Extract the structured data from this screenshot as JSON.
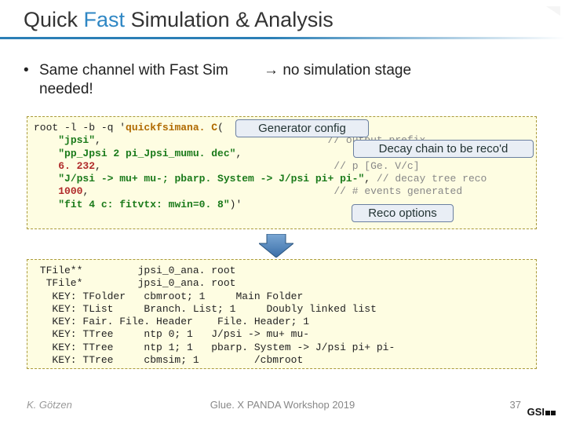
{
  "title": {
    "w1": "Quick",
    "w2": "Fast",
    "w3": "Simulation & Analysis"
  },
  "bullet": {
    "line1a": "Same channel with Fast Sim",
    "line1b": "→ no simulation stage",
    "line2": "needed!"
  },
  "callouts": {
    "gen": "Generator config",
    "decay": "Decay chain to be reco'd",
    "reco": "Reco options"
  },
  "code1": {
    "l1a": "root -l -b -q '",
    "l1b": "quickfsimana. C",
    "l1c": "(",
    "l2a": "\"jpsi\"",
    "l2b": ",",
    "l2c": "// output prefix",
    "l3a": "\"pp_Jpsi 2 pi_Jpsi_mumu. dec\"",
    "l3b": ",",
    "l4a": "6. 232",
    "l4b": ",",
    "l4c": "// p [Ge. V/c]",
    "l5a": "\"J/psi -> mu+ mu-; pbarp. System -> J/psi pi+ pi-\"",
    "l5b": ",",
    "l5c": "// decay tree reco",
    "l6a": "1000",
    "l6b": ",",
    "l6c": "// # events generated",
    "l7a": "\"fit 4 c: fitvtx: mwin=0. 8\"",
    "l7b": ")'"
  },
  "code2": {
    "l1": " TFile**         jpsi_0_ana. root",
    "l2": "  TFile*         jpsi_0_ana. root",
    "l3": "   KEY: TFolder   cbmroot; 1     Main Folder",
    "l4": "   KEY: TList     Branch. List; 1     Doubly linked list",
    "l5": "   KEY: Fair. File. Header    File. Header; 1",
    "l6": "   KEY: TTree     ntp 0; 1   J/psi -> mu+ mu-",
    "l7": "   KEY: TTree     ntp 1; 1   pbarp. System -> J/psi pi+ pi-",
    "l8": "   KEY: TTree     cbmsim; 1         /cbmroot"
  },
  "footer": {
    "author": "K. Götzen",
    "event": "Glue. X PANDA Workshop 2019",
    "page": "37",
    "logo": "GSI"
  }
}
